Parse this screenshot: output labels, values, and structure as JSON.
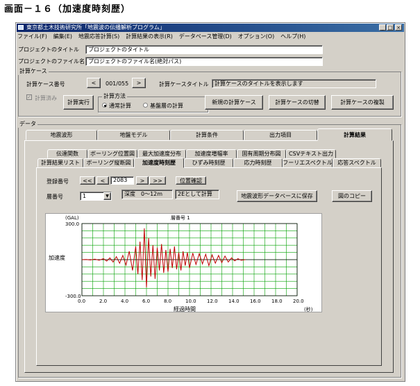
{
  "caption": "画面－１６（加速度時刻歴）",
  "window": {
    "title": "東京都土木技術研究所「地震波の伝播解析プログラム」",
    "min": "_",
    "max": "□",
    "close": "×"
  },
  "menu": [
    "ファイル(F)",
    "編集(E)",
    "地震応答計算(S)",
    "計算結果の表示(R)",
    "データベース管理(D)",
    "オプション(O)",
    "ヘルプ(H)"
  ],
  "project": {
    "title_label": "プロジェクトのタイトル",
    "title_value": "プロジェクトのタイトル",
    "file_label": "プロジェクトのファイル名",
    "file_value": "プロジェクトのファイル名(絶対パス)"
  },
  "calc_case": {
    "group_label": "計算ケース",
    "number_label": "計算ケース番号",
    "prev": "<",
    "number_value": "001/055",
    "next": ">",
    "title_label": "計算ケースタイトル",
    "title_value": "計算ケースのタイトルを表示します",
    "done_label": "計算済み",
    "run_button": "計算実行",
    "method_label": "計算方法",
    "method_normal": "通常計算",
    "method_base": "基盤層の計算",
    "new_button": "新規の計算ケース",
    "switch_button": "計算ケースの切替",
    "copy_button": "計算ケースの複製"
  },
  "data_group_label": "データ",
  "main_tabs": [
    "地震波形",
    "地盤モデル",
    "計算条件",
    "出力項目",
    "計算結果"
  ],
  "sub_tabs_row1": [
    "伝達関数",
    "ボーリング位置図",
    "最大加速度分布",
    "加速度増幅率",
    "固有周期分布図",
    "CSVテキスト出力"
  ],
  "sub_tabs_row2": [
    "計算結果リスト",
    "ボーリング縦断図",
    "加速度時刻歴",
    "ひずみ時刻歴",
    "応力時刻歴",
    "フーリエスペクトル",
    "応答スペクトル"
  ],
  "controls": {
    "reg_label": "登録番号",
    "first": "<<",
    "prev": "<",
    "reg_value": "2083",
    "next": ">",
    "last": ">>",
    "pos_button": "位置確認",
    "layer_label": "層番号",
    "layer_value": "1",
    "depth_value": "深度　0～12m",
    "calc_value": "2Eとして計算",
    "save_button": "地震波形データベースに保存",
    "copy_button": "図のコピー"
  },
  "chart_data": {
    "type": "line",
    "title": "層番号 1",
    "unit_label": "(GAL)",
    "ylabel": "加速度",
    "xlabel": "経過時間",
    "x_unit": "(秒)",
    "ylim": [
      -300,
      300
    ],
    "xlim": [
      0,
      20
    ],
    "y_ticks": [
      "300.0",
      "-300.0"
    ],
    "x_ticks": [
      "0.0",
      "2.0",
      "4.0",
      "6.0",
      "8.0",
      "10.0",
      "12.0",
      "14.0",
      "16.0",
      "18.0",
      "20.0"
    ],
    "grid": true,
    "line_color": "#c00000",
    "grid_color": "#00a000",
    "series": [
      {
        "x": [
          0.0,
          0.4,
          0.8,
          1.2,
          1.6,
          2.0,
          2.3,
          2.6,
          2.9,
          3.2,
          3.5,
          3.8,
          4.1,
          4.4,
          4.7,
          5.0,
          5.2,
          5.4,
          5.6,
          5.8,
          6.0,
          6.2,
          6.4,
          6.6,
          6.8,
          7.0,
          7.2,
          7.4,
          7.6,
          7.8,
          8.0,
          8.2,
          8.4,
          8.6,
          8.8,
          9.0,
          9.2,
          9.4,
          9.6,
          9.8,
          10.0,
          10.3,
          10.6,
          10.9,
          11.2,
          11.5,
          11.8,
          12.1,
          12.4,
          12.7,
          13.0,
          13.3,
          13.6,
          13.9,
          14.2,
          14.5,
          14.8,
          15.2
        ],
        "y": [
          0,
          2,
          -3,
          4,
          -5,
          8,
          -12,
          15,
          -20,
          25,
          -30,
          35,
          -45,
          70,
          -90,
          110,
          -120,
          150,
          -170,
          260,
          -230,
          180,
          -140,
          120,
          -160,
          100,
          -90,
          130,
          -110,
          80,
          -100,
          90,
          -70,
          110,
          -80,
          60,
          -90,
          70,
          -50,
          60,
          -70,
          55,
          -40,
          50,
          -35,
          45,
          -50,
          40,
          -30,
          35,
          -25,
          30,
          -20,
          15,
          -10,
          8,
          -5,
          0
        ]
      }
    ]
  }
}
